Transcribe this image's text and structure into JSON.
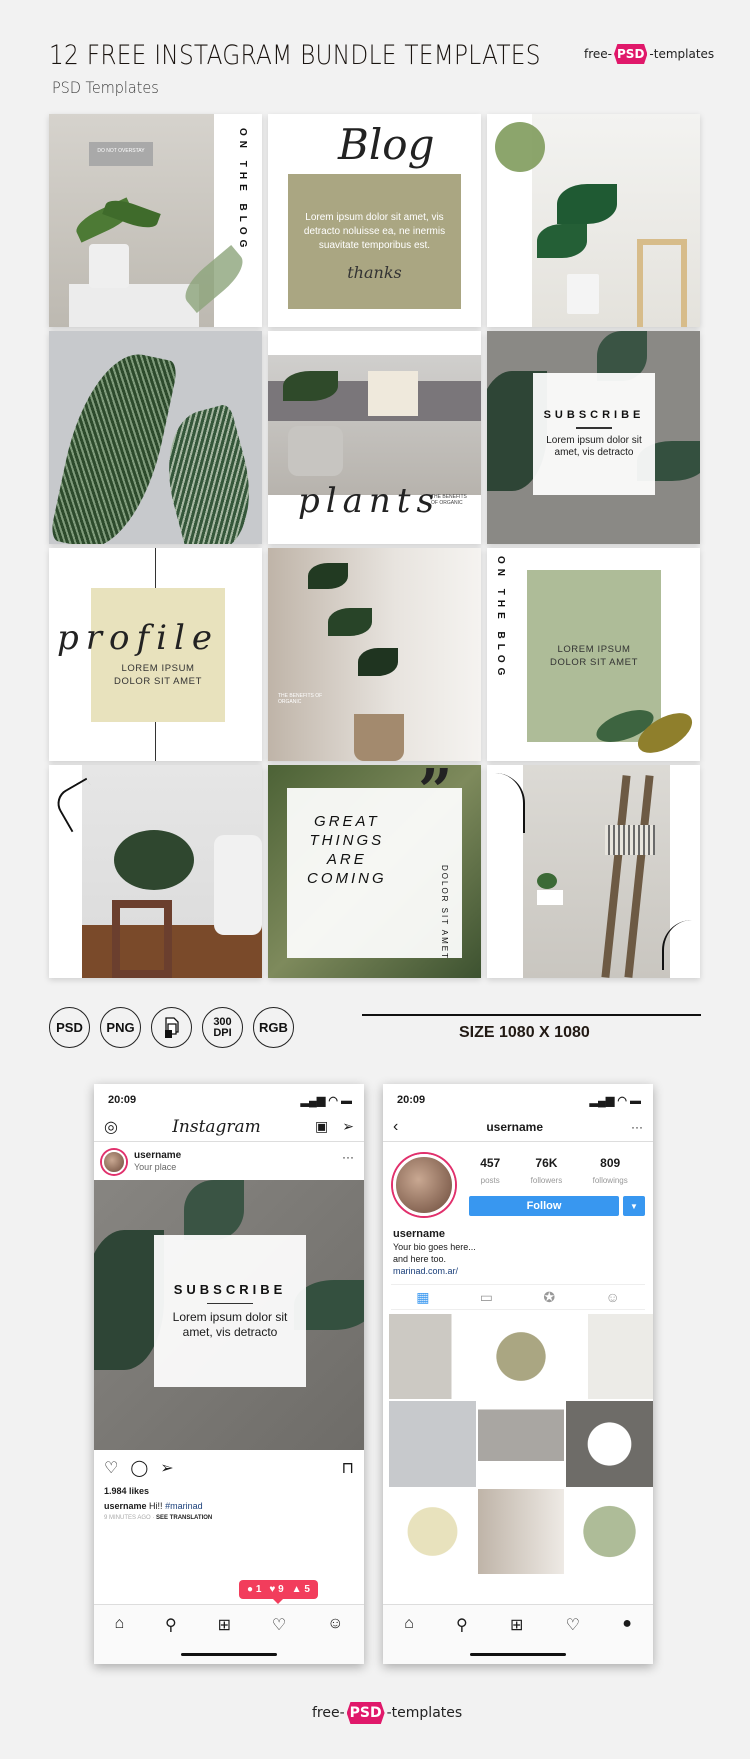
{
  "header": {
    "title": "12 FREE INSTAGRAM BUNDLE TEMPLATES",
    "subtitle": "PSD Templates",
    "logo": {
      "left": "free-",
      "mid": "PSD",
      "right": "-templates"
    }
  },
  "templates": [
    {
      "name": "on-the-blog-1",
      "vertical_text": "ON THE BLOG"
    },
    {
      "name": "blog",
      "script": "Blog",
      "body": "Lorem ipsum dolor sit amet, vis detracto noluisse ea, ne inermis suavitate temporibus est.",
      "signoff": "thanks"
    },
    {
      "name": "monstera-photo"
    },
    {
      "name": "palm-photo"
    },
    {
      "name": "plants",
      "script": "plants",
      "circle_text": "THE BENEFITS OF ORGANIC"
    },
    {
      "name": "subscribe",
      "title": "SUBSCRIBE",
      "body": "Lorem ipsum dolor sit amet, vis detracto"
    },
    {
      "name": "profile",
      "script": "profile",
      "body": "LOREM IPSUM DOLOR SIT AMET"
    },
    {
      "name": "zz-plant",
      "circle_text": "THE BENEFITS OF ORGANIC"
    },
    {
      "name": "on-the-blog-2",
      "vertical_text": "ON THE BLOG",
      "body": "LOREM IPSUM DOLOR SIT AMET"
    },
    {
      "name": "living-room-photo"
    },
    {
      "name": "great-things",
      "quote": "”",
      "lines": [
        "GREAT",
        "THINGS",
        "ARE",
        "COMING"
      ],
      "vertical_text": "DOLOR SIT AMET"
    },
    {
      "name": "ladder-photo"
    }
  ],
  "formats": [
    "PSD",
    "PNG",
    "layers-icon",
    "300 DPI",
    "RGB"
  ],
  "format_dpi": {
    "top": "300",
    "bottom": "DPI"
  },
  "size_label": "SIZE 1080 X 1080",
  "feed_phone": {
    "time": "20:09",
    "app_title": "Instagram",
    "username": "username",
    "location": "Your place",
    "post": {
      "title": "SUBSCRIBE",
      "body": "Lorem ipsum dolor sit amet, vis detracto"
    },
    "likes": "1.984 likes",
    "caption_user": "username",
    "caption_text": "Hi!!",
    "caption_tag": "#marinad",
    "time_ago": "9 MINUTES AGO",
    "see_translation": "SEE TRANSLATION",
    "notifications": {
      "comments": "1",
      "likes": "9",
      "follows": "5"
    }
  },
  "profile_phone": {
    "time": "20:09",
    "username": "username",
    "stats": [
      {
        "value": "457",
        "label": "posts"
      },
      {
        "value": "76K",
        "label": "followers"
      },
      {
        "value": "809",
        "label": "followings"
      }
    ],
    "follow_label": "Follow",
    "display_name": "username",
    "bio_line1": "Your bio goes here...",
    "bio_line2": "and here too.",
    "link": "marinad.com.ar/"
  },
  "colors": {
    "accent_pink": "#e0186a",
    "follow_blue": "#3897f0",
    "notif_red": "#f23d5c",
    "sage": "#aebc98",
    "olive": "#aaa682"
  }
}
